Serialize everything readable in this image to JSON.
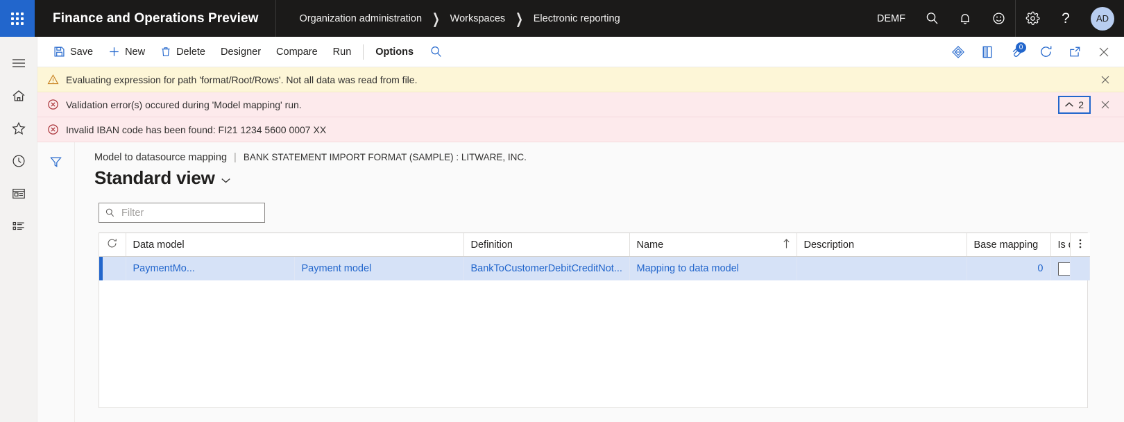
{
  "topbar": {
    "waffle_label": "app-launcher",
    "app_title": "Finance and Operations Preview",
    "breadcrumb": [
      "Organization administration",
      "Workspaces",
      "Electronic reporting"
    ],
    "company": "DEMF",
    "icons": [
      "search-icon",
      "notifications-icon",
      "feedback-icon",
      "settings-icon",
      "help-icon"
    ],
    "avatar_initials": "AD"
  },
  "sidebar": {
    "items": [
      {
        "name": "navigation-menu",
        "icon": "hamburger-icon"
      },
      {
        "name": "home",
        "icon": "home-icon"
      },
      {
        "name": "favorites",
        "icon": "star-icon"
      },
      {
        "name": "recent",
        "icon": "clock-icon"
      },
      {
        "name": "workspaces",
        "icon": "workspace-icon"
      },
      {
        "name": "modules",
        "icon": "list-icon"
      }
    ]
  },
  "actionpane": {
    "buttons": [
      {
        "label": "Save",
        "icon": "save-icon"
      },
      {
        "label": "New",
        "icon": "plus-icon"
      },
      {
        "label": "Delete",
        "icon": "trash-icon"
      },
      {
        "label": "Designer",
        "icon": ""
      },
      {
        "label": "Compare",
        "icon": ""
      },
      {
        "label": "Run",
        "icon": ""
      }
    ],
    "options_label": "Options",
    "search_icon": "search-icon",
    "right_icons": [
      {
        "name": "personalize-icon",
        "badge": ""
      },
      {
        "name": "office-icon",
        "badge": ""
      },
      {
        "name": "attachments-icon",
        "badge": "0"
      },
      {
        "name": "refresh-icon",
        "badge": ""
      },
      {
        "name": "popout-icon",
        "badge": ""
      },
      {
        "name": "close-icon",
        "badge": ""
      }
    ]
  },
  "messages": [
    {
      "type": "warning",
      "icon": "warning-triangle-icon",
      "text": "Evaluating expression for path 'format/Root/Rows'.   Not all data was read from file.",
      "close_icon": "close-icon"
    },
    {
      "type": "error",
      "icon": "error-circle-icon",
      "text": "Validation error(s) occured during 'Model mapping' run.",
      "collapse_icon": "chevron-up-icon",
      "collapse_count": "2",
      "close_icon": "close-icon"
    },
    {
      "type": "error",
      "icon": "error-circle-icon",
      "text": "Invalid IBAN code has been found: FI21 1234 5600 0007 XX",
      "close_icon": ""
    }
  ],
  "page": {
    "filter_pane_icon": "filter-icon",
    "caption_primary": "Model to datasource mapping",
    "caption_separator": "|",
    "caption_secondary": "BANK STATEMENT IMPORT FORMAT (SAMPLE) : LITWARE, INC.",
    "view_name": "Standard view",
    "view_chevron": "chevron-down-icon",
    "filter": {
      "icon": "search-icon",
      "value": "",
      "placeholder": "Filter"
    }
  },
  "grid": {
    "refresh_icon": "refresh-icon",
    "menu_icon": "more-vertical-icon",
    "columns": [
      {
        "label": "Data model",
        "sorted": false
      },
      {
        "label": "Definition",
        "sorted": false
      },
      {
        "label": "Name",
        "sorted": true,
        "sort_icon": "arrow-up-icon"
      },
      {
        "label": "Description",
        "sorted": false
      },
      {
        "label": "Base mapping",
        "sorted": false
      },
      {
        "label": "Is deleted",
        "sorted": false
      }
    ],
    "rows": [
      {
        "selected": true,
        "data_model_id": "PaymentMo...",
        "data_model_name": "Payment model",
        "definition": "BankToCustomerDebitCreditNot...",
        "name": "Mapping to data model",
        "description": "",
        "base_mapping": "0",
        "is_deleted_checked": false
      }
    ]
  },
  "colors": {
    "accent": "#2266cc",
    "topbar_bg": "#1b1a19",
    "warning_bg": "#fdf6d7",
    "error_bg": "#fdeaec",
    "selected_row_bg": "#d6e2f7"
  }
}
